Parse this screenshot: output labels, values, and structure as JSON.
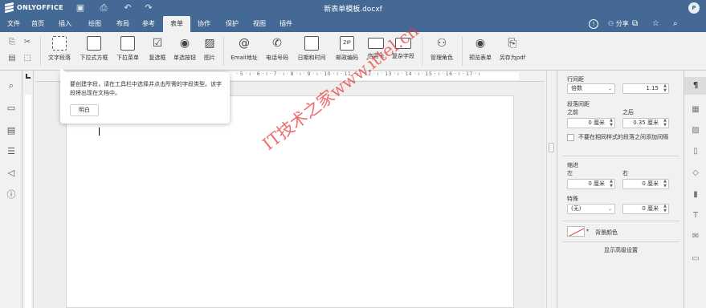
{
  "app": {
    "brand": "ONLYOFFICE",
    "doc_title": "新表单模板.docxf",
    "user_initials": "P"
  },
  "quick": {
    "save_icon": "save-icon",
    "print_icon": "print-icon",
    "undo_icon": "undo-icon",
    "redo_icon": "redo-icon"
  },
  "menu": {
    "tabs": [
      "文件",
      "首页",
      "插入",
      "绘图",
      "布局",
      "参考",
      "表单",
      "协作",
      "保护",
      "视图",
      "插件"
    ],
    "active": "表单",
    "share": "分享",
    "accent": "#446995"
  },
  "toolbar": {
    "buttons": [
      "文字段落",
      "下拉式方框",
      "下拉菜单",
      "复选框",
      "单选按钮",
      "图片",
      "Email地址",
      "电话号码",
      "日期和时间",
      "邮政编码",
      "信用卡",
      "复杂字段",
      "管理角色",
      "预览表单",
      "另存为pdf"
    ]
  },
  "ruler": {
    "numbers": "· 5 · ı · 6 · ı · 7 · ı · 8 · ı · 9 · ı · 10 · ı · 11 · ı · 12 · ı · 13 · ı · 14 · ı · 15 · ı · 16 · ı · 17 · ı"
  },
  "tooltip": {
    "text": "要创建字段，请在工具栏中选择并点击所需的字段类型。该字段将出现在文档中。",
    "button": "明白"
  },
  "watermark": "IT技术之家www.ittel.cn",
  "panel": {
    "line_spacing_label": "行间距",
    "line_spacing_type": "倍数",
    "line_spacing_value": "1.15",
    "para_spacing_label": "段落间距",
    "before_label": "之前",
    "after_label": "之后",
    "before_value": "0 厘米",
    "after_value": "0.35 厘米",
    "no_space_label": "不要在相同样式的段落之间添加间隔",
    "indent_label": "缩进",
    "left_label": "左",
    "right_label": "右",
    "left_value": "0 厘米",
    "right_value": "0 厘米",
    "special_label": "特殊",
    "special_type": "(无)",
    "special_value": "0 厘米",
    "bg_color_label": "背景颜色",
    "advanced_link": "显示高级设置"
  }
}
